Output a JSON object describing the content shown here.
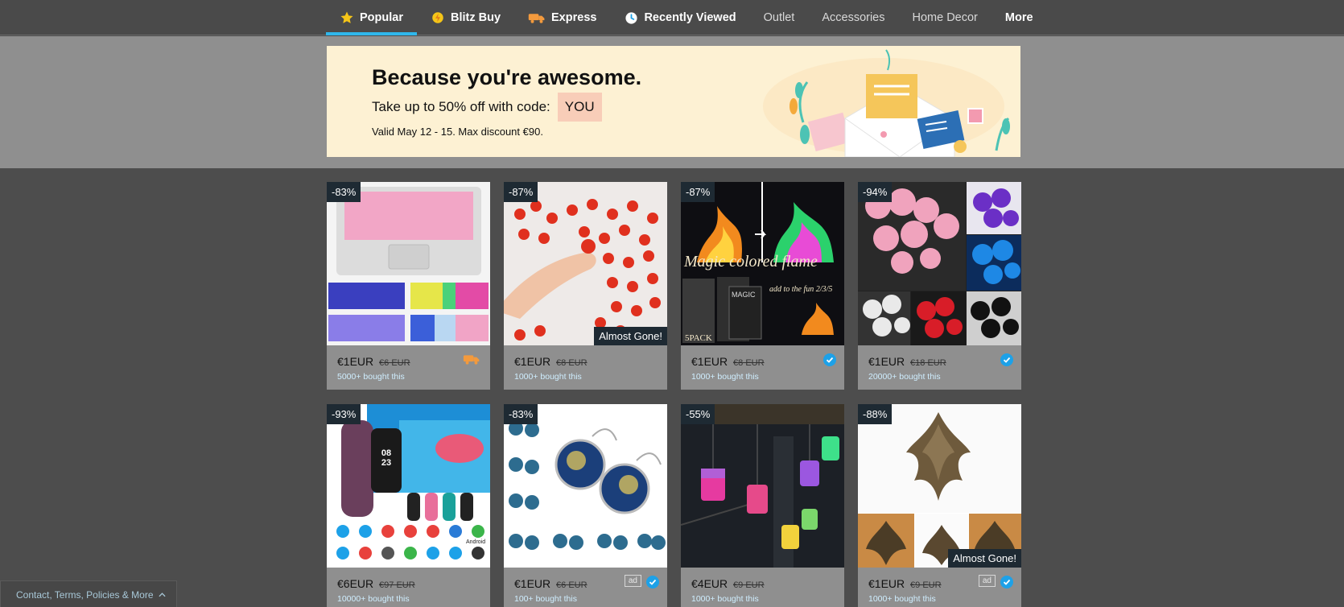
{
  "nav": {
    "items": [
      {
        "label": "Popular",
        "icon": "star-icon",
        "active": true
      },
      {
        "label": "Blitz Buy",
        "icon": "blitz-coin-icon"
      },
      {
        "label": "Express",
        "icon": "express-truck-icon"
      },
      {
        "label": "Recently Viewed",
        "icon": "clock-icon"
      },
      {
        "label": "Outlet"
      },
      {
        "label": "Accessories"
      },
      {
        "label": "Home Decor"
      },
      {
        "label": "More"
      }
    ]
  },
  "banner": {
    "title": "Because you're awesome.",
    "subtitle": "Take up to 50% off with code:",
    "code": "YOU",
    "valid": "Valid May 12 - 15. Max discount €90."
  },
  "products": [
    {
      "discount": "-83%",
      "price": "€1EUR",
      "old_price": "€6 EUR",
      "bought": "5000+ bought this",
      "badge": "express-truck-icon"
    },
    {
      "discount": "-87%",
      "price": "€1EUR",
      "old_price": "€8 EUR",
      "bought": "1000+ bought this",
      "overlay": "Almost Gone!"
    },
    {
      "discount": "-87%",
      "price": "€1EUR",
      "old_price": "€8 EUR",
      "bought": "1000+ bought this",
      "badge": "verified-icon",
      "image_text": "Magic colored flame",
      "image_caption": "add to the fun 2/3/5",
      "image_pack": "5PACK",
      "image_product": "MAGIC"
    },
    {
      "discount": "-94%",
      "price": "€1EUR",
      "old_price": "€18 EUR",
      "bought": "20000+ bought this",
      "badge": "verified-icon"
    },
    {
      "discount": "-93%",
      "price": "€6EUR",
      "old_price": "€97 EUR",
      "bought": "10000+ bought this",
      "image_time": "08 23",
      "image_os": "Android"
    },
    {
      "discount": "-83%",
      "price": "€1EUR",
      "old_price": "€6 EUR",
      "bought": "100+ bought this",
      "badge": "verified-icon",
      "ad": "ad"
    },
    {
      "discount": "-55%",
      "price": "€4EUR",
      "old_price": "€9 EUR",
      "bought": "1000+ bought this"
    },
    {
      "discount": "-88%",
      "price": "€1EUR",
      "old_price": "€9 EUR",
      "bought": "1000+ bought this",
      "badge": "verified-icon",
      "ad": "ad",
      "overlay": "Almost Gone!"
    }
  ],
  "footer": {
    "link": "Contact, Terms, Policies & More"
  },
  "colors": {
    "accent": "#2fb7ec",
    "verified": "#1da1e8",
    "express": "#f39a3d",
    "banner_bg": "#fdf1d3",
    "code_bg": "#f8cdb8"
  }
}
